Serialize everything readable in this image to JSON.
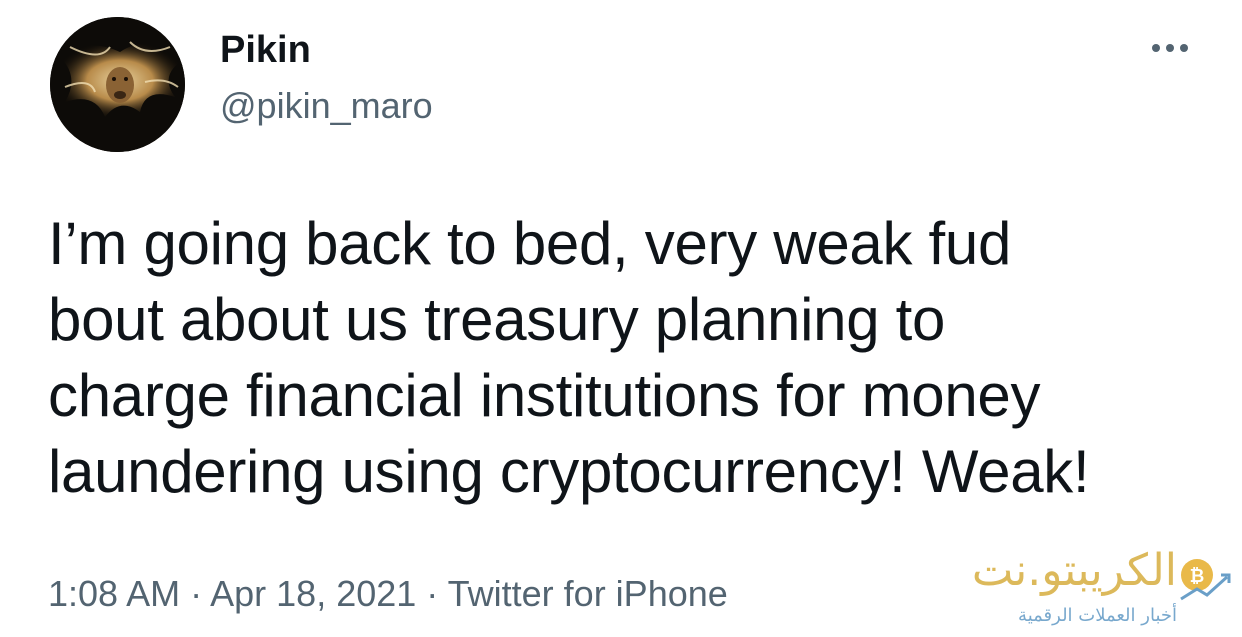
{
  "author": {
    "display_name": "Pikin",
    "handle": "@pikin_maro",
    "avatar_icon": "lion-avatar-icon"
  },
  "tweet": {
    "lines": [
      "I’m going back to bed, very weak fud",
      "bout about us treasury planning to",
      "charge financial institutions for money",
      "laundering using cryptocurrency! Weak!"
    ],
    "time": "1:08 AM",
    "separator": "·",
    "date": "Apr 18, 2021",
    "source": "Twitter for iPhone"
  },
  "menu": {
    "more_icon": "more-horizontal-icon"
  },
  "watermark": {
    "title": "الكريبتو.نت",
    "subtitle": "أخبار العملات الرقمية",
    "logo_icon": "bitcoin-chart-icon",
    "colors": {
      "gold": "#d9b24a",
      "blue": "#6a9fc8"
    }
  },
  "colors": {
    "text_primary": "#0f1419",
    "text_secondary": "#536471",
    "background": "#ffffff"
  }
}
